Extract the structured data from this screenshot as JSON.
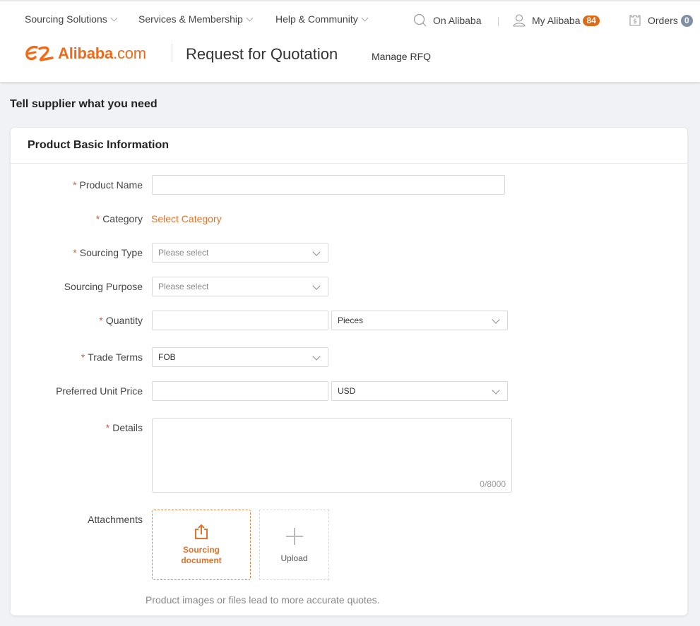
{
  "header": {
    "top_nav": [
      {
        "label": "Sourcing Solutions"
      },
      {
        "label": "Services & Membership"
      },
      {
        "label": "Help & Community"
      }
    ],
    "search_label": "On Alibaba",
    "my_alibaba": {
      "label": "My Alibaba",
      "badge": "84"
    },
    "orders": {
      "label": "Orders",
      "badge": "0"
    },
    "logo": {
      "word": "Alibaba",
      "domain": ".com"
    },
    "page_title": "Request for Quotation",
    "manage_link": "Manage RFQ"
  },
  "colors": {
    "brand": "#f06a1a",
    "accent_link": "#e0732d",
    "required": "#e5582a",
    "badge_orange": "#e06a14",
    "badge_grey": "#7f8fa6"
  },
  "main": {
    "section_title": "Tell supplier what you need",
    "card_title": "Product Basic Information",
    "fields": {
      "product_name": {
        "label": "Product Name",
        "required": true,
        "value": "",
        "placeholder": ""
      },
      "category": {
        "label": "Category",
        "required": true,
        "link": "Select Category"
      },
      "sourcing_type": {
        "label": "Sourcing Type",
        "required": true,
        "placeholder": "Please select"
      },
      "sourcing_purpose": {
        "label": "Sourcing Purpose",
        "required": false,
        "placeholder": "Please select"
      },
      "quantity": {
        "label": "Quantity",
        "required": true,
        "value": "",
        "unit": "Pieces"
      },
      "trade_terms": {
        "label": "Trade Terms",
        "required": true,
        "value": "FOB"
      },
      "unit_price": {
        "label": "Preferred Unit Price",
        "required": false,
        "value": "",
        "currency": "USD"
      },
      "details": {
        "label": "Details",
        "required": true,
        "value": "",
        "counter": "0/8000"
      },
      "attachments": {
        "label": "Attachments",
        "sourcing_doc_line1": "Sourcing",
        "sourcing_doc_line2": "document",
        "upload_label": "Upload",
        "hint": "Product images or files lead to more accurate quotes."
      }
    },
    "required_mark": "*"
  }
}
